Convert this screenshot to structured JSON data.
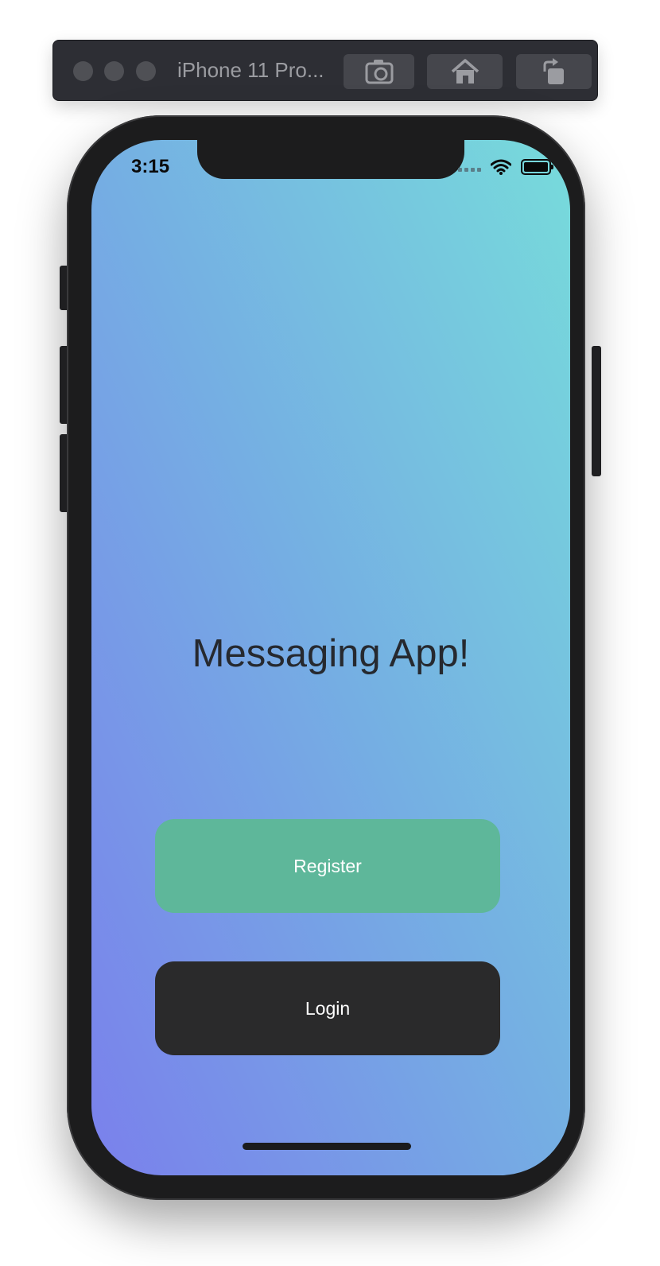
{
  "simulator": {
    "title": "iPhone 11 Pro...",
    "toolbar_buttons": [
      {
        "name": "screenshot",
        "icon": "camera-icon"
      },
      {
        "name": "home",
        "icon": "home-icon"
      },
      {
        "name": "rotate",
        "icon": "rotate-icon"
      }
    ]
  },
  "status_bar": {
    "time": "3:15",
    "icons": [
      "signal-dots-icon",
      "wifi-icon",
      "battery-icon"
    ]
  },
  "app": {
    "title": "Messaging App!",
    "register_label": "Register",
    "login_label": "Login"
  },
  "colors": {
    "gradient_start": "#7a80ec",
    "gradient_mid": "#75aee3",
    "gradient_end": "#77dbdb",
    "register_button": "#5eb79a",
    "login_button": "#2a2a2b",
    "title_text": "#26292f"
  }
}
